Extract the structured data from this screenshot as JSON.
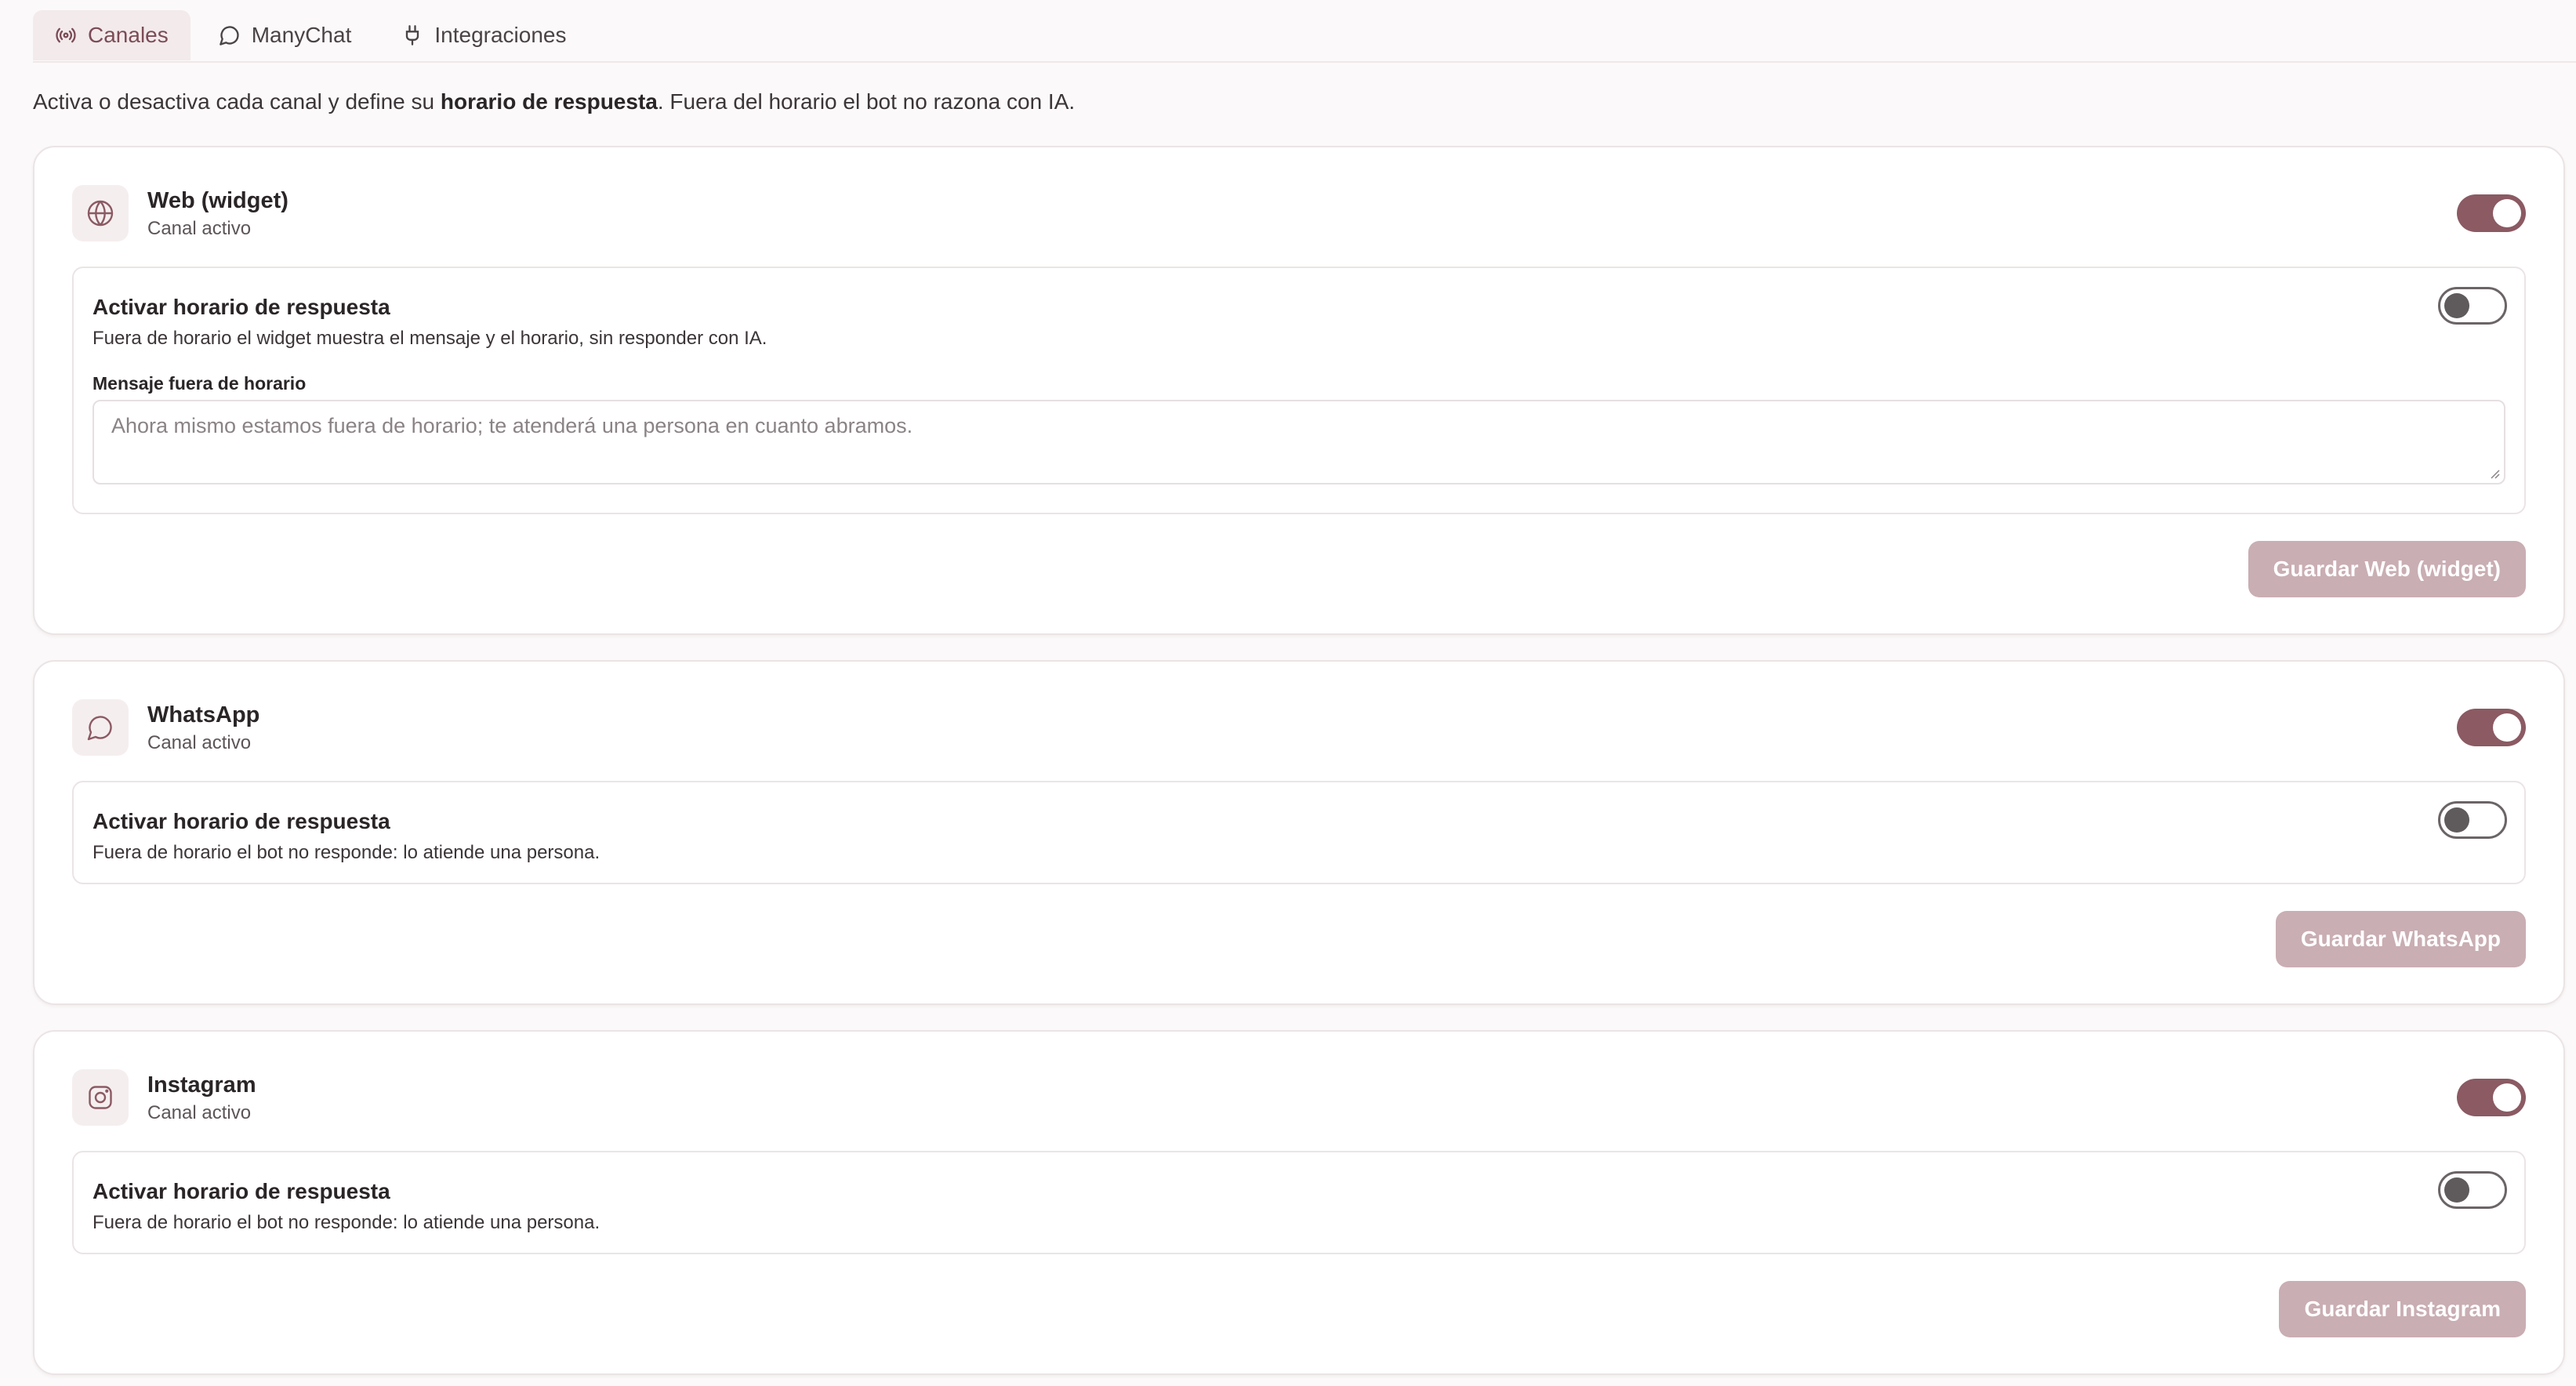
{
  "tabs": [
    {
      "label": "Canales",
      "icon": "radio-broadcast-icon",
      "active": true
    },
    {
      "label": "ManyChat",
      "icon": "chat-bubble-icon",
      "active": false
    },
    {
      "label": "Integraciones",
      "icon": "plug-icon",
      "active": false
    }
  ],
  "intro": {
    "before": "Activa o desactiva cada canal y define su ",
    "bold": "horario de respuesta",
    "after": ". Fuera del horario el bot no razona con IA."
  },
  "channels": [
    {
      "name": "Web (widget)",
      "status": "Canal activo",
      "icon": "globe-icon",
      "enabled": true,
      "schedule_title": "Activar horario de respuesta",
      "schedule_desc": "Fuera de horario el widget muestra el mensaje y el horario, sin responder con IA.",
      "schedule_enabled": false,
      "message_label": "Mensaje fuera de horario",
      "message_placeholder": "Ahora mismo estamos fuera de horario; te atenderá una persona en cuanto abramos.",
      "save_label": "Guardar Web (widget)"
    },
    {
      "name": "WhatsApp",
      "status": "Canal activo",
      "icon": "chat-bubble-icon",
      "enabled": true,
      "schedule_title": "Activar horario de respuesta",
      "schedule_desc": "Fuera de horario el bot no responde: lo atiende una persona.",
      "schedule_enabled": false,
      "save_label": "Guardar WhatsApp"
    },
    {
      "name": "Instagram",
      "status": "Canal activo",
      "icon": "instagram-icon",
      "enabled": true,
      "schedule_title": "Activar horario de respuesta",
      "schedule_desc": "Fuera de horario el bot no responde: lo atiende una persona.",
      "schedule_enabled": false,
      "save_label": "Guardar Instagram"
    }
  ],
  "colors": {
    "accent": "#8b5a63",
    "save_button_disabled": "#c9aeb3",
    "active_tab_bg": "#f3eaeb"
  }
}
